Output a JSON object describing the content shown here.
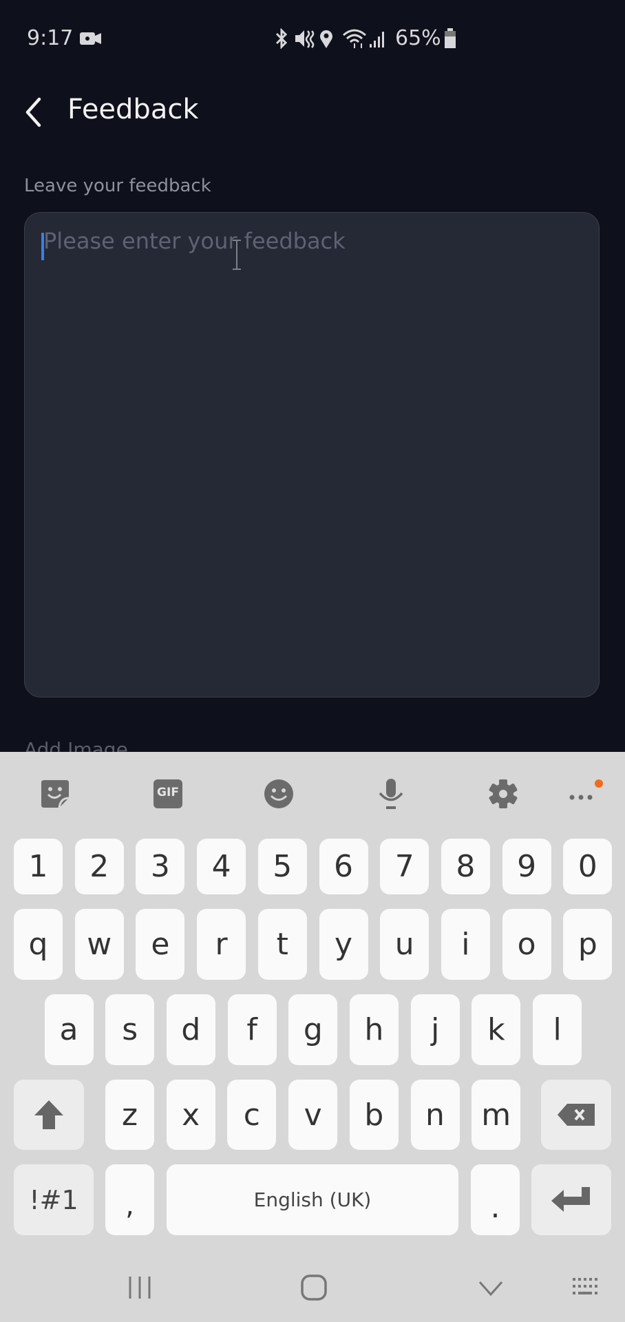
{
  "status_bar": {
    "time": "9:17",
    "battery": "65%",
    "icons": [
      "video-recording-icon",
      "bluetooth-icon",
      "mute-icon",
      "location-icon",
      "wifi-icon",
      "signal-icon",
      "battery-icon"
    ]
  },
  "header": {
    "back_icon": "chevron-left-icon",
    "title": "Feedback"
  },
  "form": {
    "feedback_label": "Leave your feedback",
    "feedback_placeholder": "Please enter your feedback",
    "feedback_value": "",
    "add_image_label": "Add Image"
  },
  "keyboard": {
    "toolbar": [
      "sticker-icon",
      "gif-icon",
      "emoji-icon",
      "microphone-icon",
      "settings-icon",
      "more-icon"
    ],
    "gif_label": "GIF",
    "notification_color": "#f26a1b",
    "rows": [
      [
        "1",
        "2",
        "3",
        "4",
        "5",
        "6",
        "7",
        "8",
        "9",
        "0"
      ],
      [
        "q",
        "w",
        "e",
        "r",
        "t",
        "y",
        "u",
        "i",
        "o",
        "p"
      ],
      [
        "a",
        "s",
        "d",
        "f",
        "g",
        "h",
        "j",
        "k",
        "l"
      ],
      [
        "z",
        "x",
        "c",
        "v",
        "b",
        "n",
        "m"
      ]
    ],
    "symbols_label": "!#1",
    "comma": ",",
    "space_label": "English (UK)",
    "period": "."
  },
  "nav_bar": {
    "icons": [
      "recent-apps-icon",
      "home-icon",
      "back-icon",
      "keyboard-switch-icon"
    ]
  },
  "colors": {
    "background": "#0e101b",
    "input_bg": "#252835",
    "caret": "#3d7de8",
    "keyboard_bg": "#d7d7d7"
  }
}
